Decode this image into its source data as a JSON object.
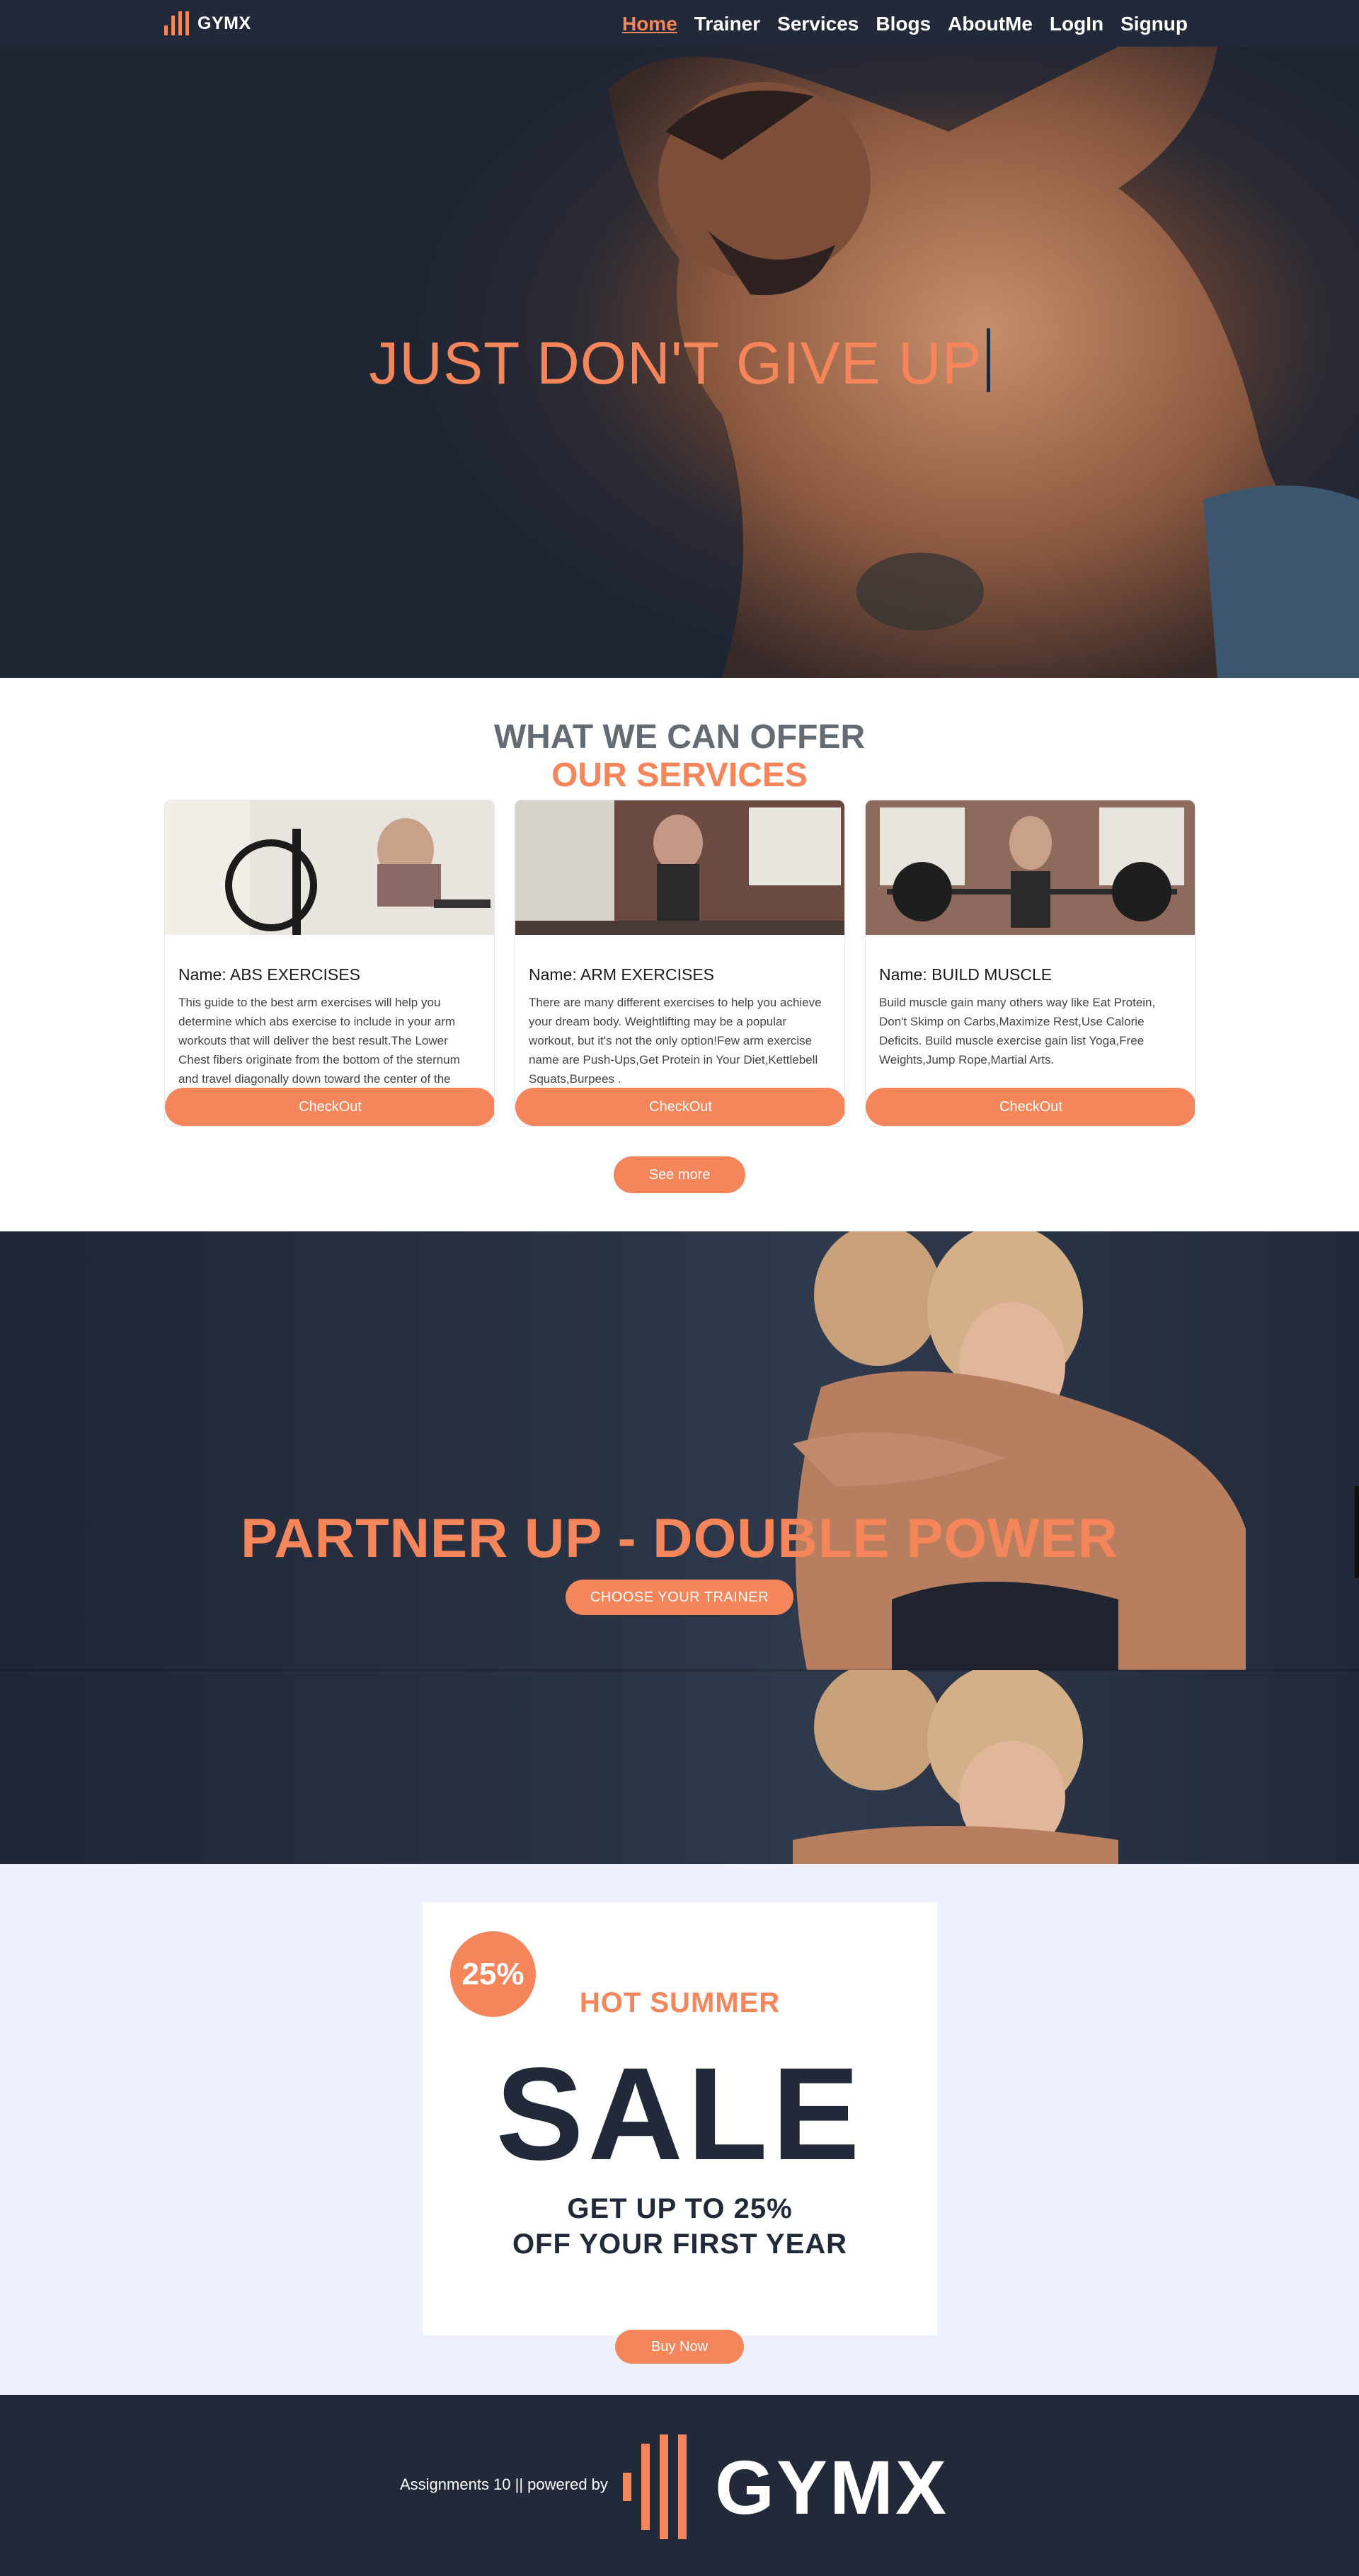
{
  "brand": {
    "name": "GYMX"
  },
  "nav": {
    "links": [
      "Home",
      "Trainer",
      "Services",
      "Blogs",
      "AboutMe",
      "LogIn",
      "Signup"
    ],
    "active": "Home"
  },
  "hero": {
    "title": "JUST DON'T GIVE UP"
  },
  "services": {
    "heading": "WHAT WE CAN OFFER",
    "subheading": "OUR SERVICES",
    "cards": [
      {
        "name": "Name: ABS EXERCISES",
        "description": "This guide to the best arm exercises will help you determine which abs exercise to include in your arm workouts that will deliver the best result.The Lower Chest fibers originate from the bottom of the sternum and travel diagonally down toward the center of the chest.",
        "button": "CheckOut"
      },
      {
        "name": "Name: ARM EXERCISES",
        "description": "There are many different exercises to help you achieve your dream body. Weightlifting may be a popular workout, but it's not the only option!Few arm exercise name are Push-Ups,Get Protein in Your Diet,Kettlebell Squats,Burpees .",
        "button": "CheckOut"
      },
      {
        "name": "Name: BUILD MUSCLE",
        "description": "Build muscle gain many others way like Eat Protein, Don't Skimp on Carbs,Maximize Rest,Use Calorie Deficits. Build muscle exercise gain list Yoga,Free Weights,Jump Rope,Martial Arts.",
        "button": "CheckOut"
      }
    ],
    "see_more": "See more"
  },
  "partner": {
    "title": "PARTNER UP - DOUBLE POWER",
    "button": "CHOOSE YOUR TRAINER"
  },
  "sale": {
    "badge": "25%",
    "hot": "HOT SUMMER",
    "word": "SALE",
    "line1": "GET UP TO 25%",
    "line2": "OFF YOUR FIRST YEAR",
    "button": "Buy Now"
  },
  "footer": {
    "text": "Assignments 10 || powered by",
    "logo_name": "GYMX"
  },
  "colors": {
    "accent": "#f5855a",
    "dark": "#222a39",
    "sale_bg": "#eef1fc",
    "heading_gray": "#656b72"
  }
}
